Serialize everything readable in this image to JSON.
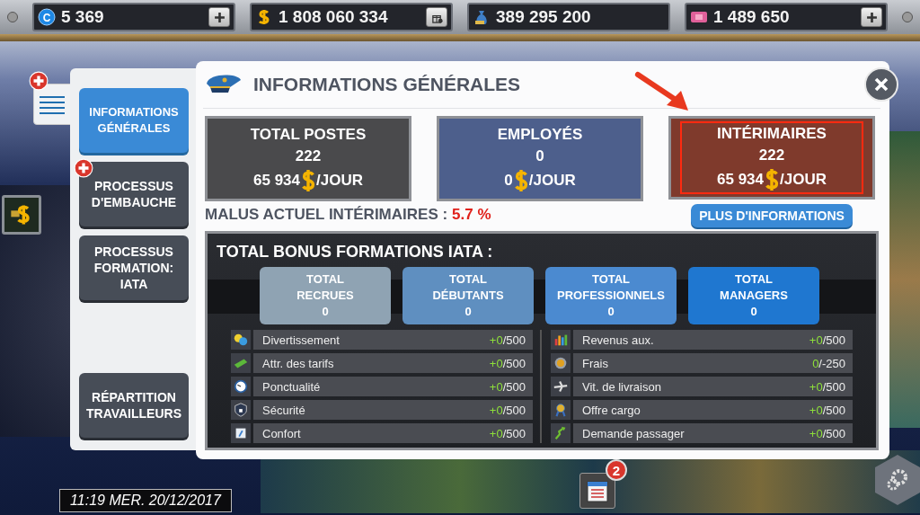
{
  "top_bar": {
    "resources": [
      {
        "kind": "coin",
        "symbol": "C",
        "value": "5 369",
        "button": {
          "kind": "plus"
        }
      },
      {
        "kind": "dollar",
        "value": "1 808 060 334",
        "button": {
          "kind": "gift"
        }
      },
      {
        "kind": "bag",
        "value": "389 295 200"
      },
      {
        "kind": "ticket",
        "value": "1 489 650",
        "button": {
          "kind": "plus"
        }
      }
    ]
  },
  "sidebar": {
    "items": [
      {
        "label": "INFORMATIONS GÉNÉRALES",
        "selected": true,
        "badge": false
      },
      {
        "label": "PROCESSUS D'EMBAUCHE",
        "selected": false,
        "badge": true
      },
      {
        "label": "PROCESSUS FORMATION: IATA",
        "selected": false,
        "badge": false
      },
      {
        "label": "RÉPARTITION TRAVAILLEURS",
        "selected": false,
        "badge": false
      }
    ]
  },
  "dialog": {
    "title": "INFORMATIONS GÉNÉRALES",
    "cards": [
      {
        "title": "TOTAL POSTES",
        "count": "222",
        "amount": "65 934",
        "unit": "/JOUR",
        "color": "#4a4a4c",
        "highlighted": false
      },
      {
        "title": "EMPLOYÉS",
        "count": "0",
        "amount": "0",
        "unit": "/JOUR",
        "color": "#4d5f8c",
        "highlighted": false
      },
      {
        "title": "INTÉRIMAIRES",
        "count": "222",
        "amount": "65 934",
        "unit": "/JOUR",
        "color": "#7f3a2c",
        "highlighted": true
      }
    ],
    "malus": {
      "label": "MALUS ACTUEL INTÉRIMAIRES :",
      "value": "5.7 %"
    },
    "more_button": "PLUS D'INFORMATIONS",
    "bonus_panel": {
      "title": "TOTAL BONUS FORMATIONS IATA :",
      "totals": [
        {
          "heading": "TOTAL",
          "label": "RECRUES",
          "value": "0",
          "color": "#8fa3b3"
        },
        {
          "heading": "TOTAL",
          "label": "DÉBUTANTS",
          "value": "0",
          "color": "#5f8fc0"
        },
        {
          "heading": "TOTAL",
          "label": "PROFESSIONNELS",
          "value": "0",
          "color": "#4b8ad0"
        },
        {
          "heading": "TOTAL",
          "label": "MANAGERS",
          "value": "0",
          "color": "#1f77d0"
        }
      ],
      "columns": [
        [
          {
            "kind": "masks",
            "label": "Divertissement",
            "gain": "+0",
            "cap": "/500"
          },
          {
            "kind": "ticket",
            "label": "Attr. des tarifs",
            "gain": "+0",
            "cap": "/500"
          },
          {
            "kind": "clock",
            "label": "Ponctualité",
            "gain": "+0",
            "cap": "/500"
          },
          {
            "kind": "shield",
            "label": "Sécurité",
            "gain": "+0",
            "cap": "/500"
          },
          {
            "kind": "seat",
            "label": "Confort",
            "gain": "+0",
            "cap": "/500"
          }
        ],
        [
          {
            "kind": "bars",
            "label": "Revenus aux.",
            "gain": "+0",
            "cap": "/500"
          },
          {
            "kind": "coin",
            "label": "Frais",
            "gain": "0",
            "cap": "/-250"
          },
          {
            "kind": "plane",
            "label": "Vit. de livraison",
            "gain": "+0",
            "cap": "/500"
          },
          {
            "kind": "medal",
            "label": "Offre cargo",
            "gain": "+0",
            "cap": "/500"
          },
          {
            "kind": "arrow",
            "label": "Demande passager",
            "gain": "+0",
            "cap": "/500"
          }
        ]
      ]
    }
  },
  "notifications": {
    "count": "2"
  },
  "clock": "11:19 MER. 20/12/2017"
}
